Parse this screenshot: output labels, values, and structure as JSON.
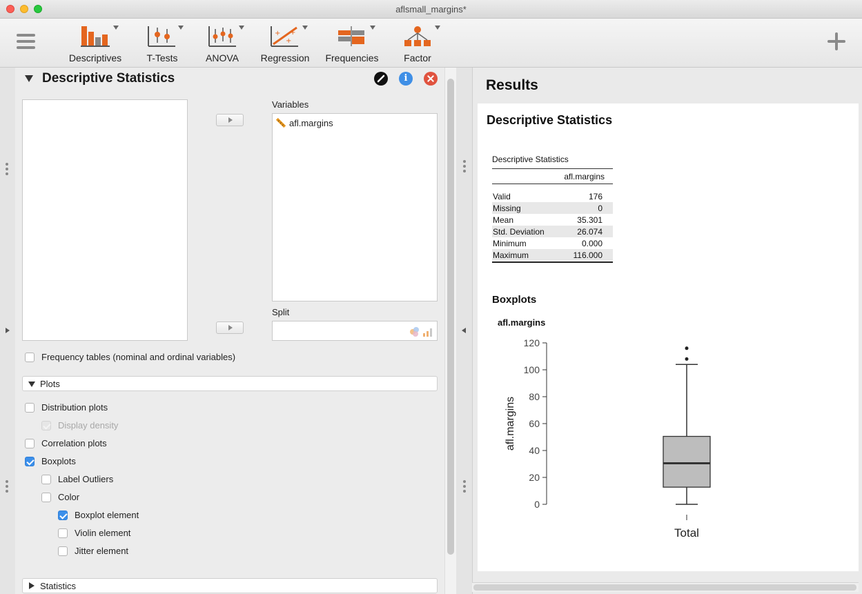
{
  "window": {
    "title": "aflsmall_margins*"
  },
  "toolbar": {
    "items": [
      {
        "label": "Descriptives",
        "icon": "descriptives-icon"
      },
      {
        "label": "T-Tests",
        "icon": "t-tests-icon"
      },
      {
        "label": "ANOVA",
        "icon": "anova-icon"
      },
      {
        "label": "Regression",
        "icon": "regression-icon"
      },
      {
        "label": "Frequencies",
        "icon": "frequencies-icon"
      },
      {
        "label": "Factor",
        "icon": "factor-icon"
      }
    ],
    "accent_color": "#e4661f"
  },
  "analysis": {
    "title": "Descriptive Statistics",
    "info_glyph": "i",
    "variables_label": "Variables",
    "variables": [
      "afl.margins"
    ],
    "split_label": "Split",
    "frequency_tables": {
      "label": "Frequency tables (nominal and ordinal variables)",
      "checked": false
    },
    "plots_section": {
      "label": "Plots",
      "distribution_plots": {
        "label": "Distribution plots",
        "checked": false
      },
      "display_density": {
        "label": "Display density",
        "checked": true,
        "disabled": true
      },
      "correlation_plots": {
        "label": "Correlation plots",
        "checked": false
      },
      "boxplots": {
        "label": "Boxplots",
        "checked": true
      },
      "label_outliers": {
        "label": "Label Outliers",
        "checked": false
      },
      "color": {
        "label": "Color",
        "checked": false
      },
      "boxplot_element": {
        "label": "Boxplot element",
        "checked": true
      },
      "violin_element": {
        "label": "Violin element",
        "checked": false
      },
      "jitter_element": {
        "label": "Jitter element",
        "checked": false
      }
    },
    "statistics_section": {
      "label": "Statistics"
    }
  },
  "results": {
    "title": "Results",
    "heading": "Descriptive Statistics",
    "table": {
      "caption": "Descriptive Statistics",
      "column": "afl.margins",
      "rows": [
        {
          "label": "Valid",
          "value": "176"
        },
        {
          "label": "Missing",
          "value": "0"
        },
        {
          "label": "Mean",
          "value": "35.301"
        },
        {
          "label": "Std. Deviation",
          "value": "26.074"
        },
        {
          "label": "Minimum",
          "value": "0.000"
        },
        {
          "label": "Maximum",
          "value": "116.000"
        }
      ]
    },
    "boxplots_heading": "Boxplots",
    "plot_title": "afl.margins"
  },
  "chart_data": {
    "type": "boxplot",
    "ylabel": "afl.margins",
    "xlabel": "Total",
    "ylim": [
      0,
      120
    ],
    "yticks": [
      0,
      20,
      40,
      60,
      80,
      100,
      120
    ],
    "box": {
      "whisker_low": 0,
      "q1": 12.75,
      "median": 30.5,
      "q3": 50.5,
      "whisker_high": 104,
      "outliers": [
        108,
        116
      ]
    },
    "box_color": "#bdbdbd"
  }
}
